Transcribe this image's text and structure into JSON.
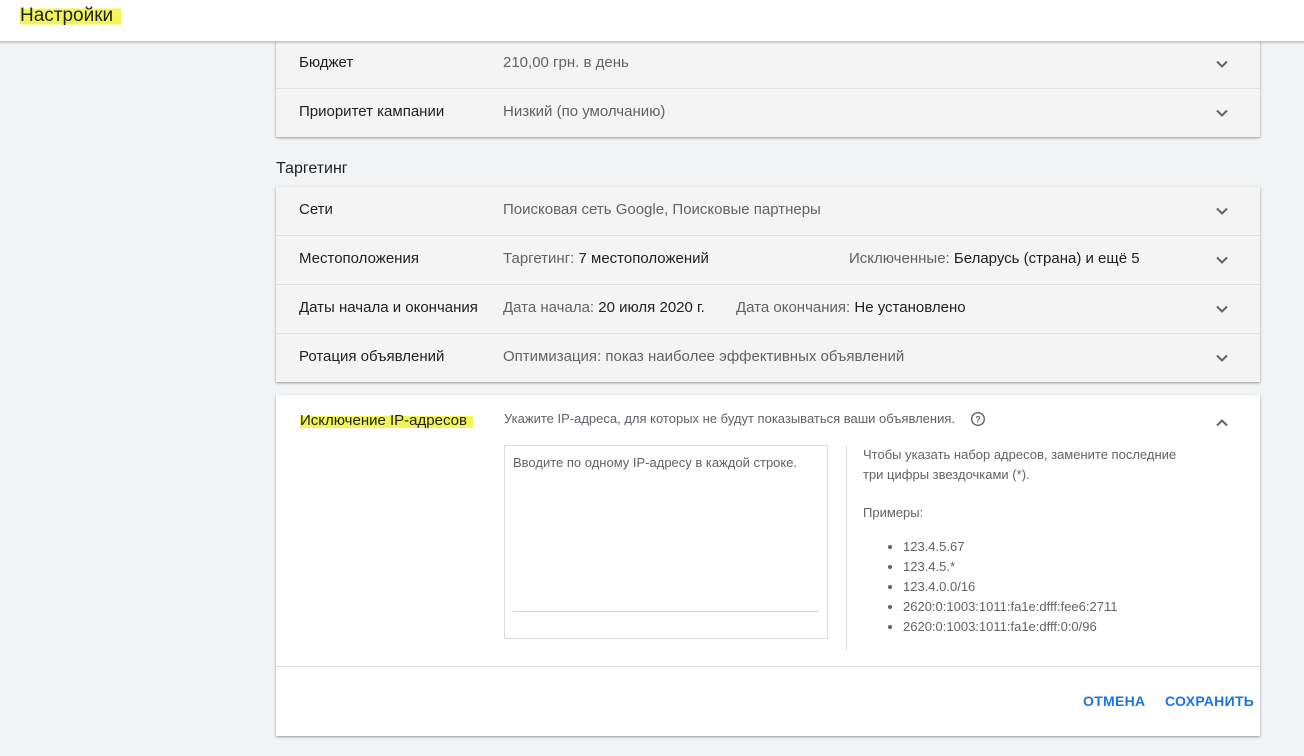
{
  "header": {
    "title": "Настройки"
  },
  "settings_top": [
    {
      "label": "Бюджет",
      "value": "210,00 грн. в день"
    },
    {
      "label": "Приоритет кампании",
      "value": "Низкий (по умолчанию)"
    }
  ],
  "targeting": {
    "title": "Таргетинг",
    "networks": {
      "label": "Сети",
      "value": "Поисковая сеть Google, Поисковые партнеры"
    },
    "locations": {
      "label": "Местоположения",
      "targeted_prefix": "Таргетинг:",
      "targeted_value": "7 местоположений",
      "excluded_prefix": "Исключенные:",
      "excluded_value": "Беларусь (страна) и ещё 5"
    },
    "dates": {
      "label": "Даты начала и окончания",
      "start_prefix": "Дата начала:",
      "start_value": "20 июля 2020 г.",
      "end_prefix": "Дата окончания:",
      "end_value": "Не установлено"
    },
    "rotation": {
      "label": "Ротация объявлений",
      "value": "Оптимизация: показ наиболее эффективных объявлений"
    }
  },
  "ip_exclusion": {
    "title": "Исключение IP-адресов",
    "description": "Укажите IP-адреса, для которых не будут показываться ваши объявления.",
    "placeholder": "Вводите по одному IP-адресу в каждой строке.",
    "hint_line1": "Чтобы указать набор адресов, замените последние",
    "hint_line2": "три цифры звездочками (*).",
    "examples_title": "Примеры:",
    "examples": [
      "123.4.5.67",
      "123.4.5.*",
      "123.4.0.0/16",
      "2620:0:1003:1011:fa1e:dfff:fee6:2711",
      "2620:0:1003:1011:fa1e:dfff:0:0/96"
    ],
    "cancel_label": "ОТМЕНА",
    "save_label": "СОХРАНИТЬ"
  },
  "colors": {
    "accent": "#1a73e8",
    "highlight": "#f2f55a"
  },
  "icons": {
    "expand": "chevron-down-icon",
    "collapse": "chevron-up-icon",
    "help": "help-circle-icon"
  }
}
